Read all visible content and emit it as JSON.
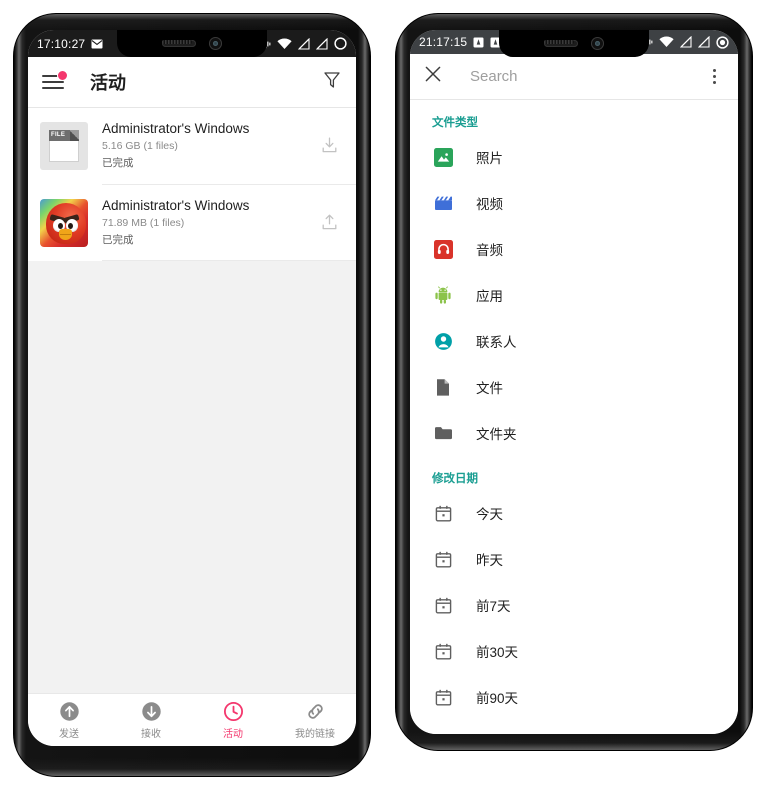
{
  "left_phone": {
    "status_bar": {
      "time": "17:10:27",
      "left_icons": [
        "mail-icon"
      ],
      "right_icons": [
        "vibrate-icon",
        "wifi-icon",
        "signal-off-icon",
        "signal-off-icon",
        "battery-circle-icon"
      ]
    },
    "app_bar": {
      "menu_icon": "hamburger-menu-icon",
      "menu_badge": true,
      "title": "活动",
      "filter_icon": "filter-funnel-icon"
    },
    "transfers": [
      {
        "thumb": "file-document-icon",
        "thumb_label": "FILE",
        "title": "Administrator's Windows",
        "size": "5.16 GB (1 files)",
        "state": "已完成",
        "action_icon": "download-icon"
      },
      {
        "thumb": "angry-birds-app-icon",
        "thumb_label": "",
        "title": "Administrator's Windows",
        "size": "71.89 MB (1 files)",
        "state": "已完成",
        "action_icon": "upload-icon"
      }
    ],
    "bottom_nav": {
      "active_color": "#f4376d",
      "inactive_color": "#8b8b8b",
      "items": [
        {
          "label": "发送",
          "icon": "arrow-up-circle-icon",
          "active": false
        },
        {
          "label": "接收",
          "icon": "arrow-down-circle-icon",
          "active": false
        },
        {
          "label": "活动",
          "icon": "clock-icon",
          "active": true
        },
        {
          "label": "我的链接",
          "icon": "link-icon",
          "active": false
        }
      ]
    }
  },
  "right_phone": {
    "status_bar": {
      "time": "21:17:15",
      "left_icons": [
        "notification-icon",
        "notification-icon"
      ],
      "right_icons": [
        "vibrate-icon",
        "wifi-icon",
        "signal-off-icon",
        "signal-off-icon",
        "battery-circle-icon"
      ]
    },
    "search_bar": {
      "close_icon": "close-x-icon",
      "placeholder": "Search",
      "value": "",
      "overflow_icon": "more-vertical-icon"
    },
    "sections": [
      {
        "heading": "文件类型",
        "heading_color": "#1a9e92",
        "items": [
          {
            "label": "照片",
            "icon": "photo-icon",
            "color": "#2aa45a"
          },
          {
            "label": "视频",
            "icon": "video-icon",
            "color": "#3f6fd8"
          },
          {
            "label": "音频",
            "icon": "audio-icon",
            "color": "#d9332a"
          },
          {
            "label": "应用",
            "icon": "android-icon",
            "color": "#8bc34a"
          },
          {
            "label": "联系人",
            "icon": "contact-icon",
            "color": "#00a0a8"
          },
          {
            "label": "文件",
            "icon": "file-icon",
            "color": "#5f5f5f"
          },
          {
            "label": "文件夹",
            "icon": "folder-icon",
            "color": "#5f5f5f"
          }
        ]
      },
      {
        "heading": "修改日期",
        "heading_color": "#1a9e92",
        "items": [
          {
            "label": "今天",
            "icon": "calendar-icon",
            "color": "#5f5f5f"
          },
          {
            "label": "昨天",
            "icon": "calendar-icon",
            "color": "#5f5f5f"
          },
          {
            "label": "前7天",
            "icon": "calendar-icon",
            "color": "#5f5f5f"
          },
          {
            "label": "前30天",
            "icon": "calendar-icon",
            "color": "#5f5f5f"
          },
          {
            "label": "前90天",
            "icon": "calendar-icon",
            "color": "#5f5f5f"
          }
        ]
      }
    ]
  }
}
